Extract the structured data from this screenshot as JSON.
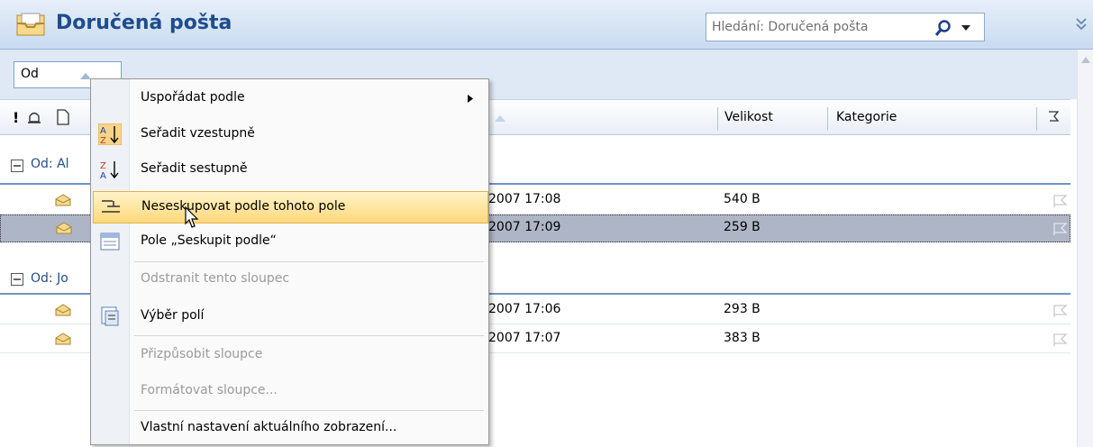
{
  "header": {
    "title": "Doručená pošta",
    "search_placeholder": "Hledání: Doručená pošta"
  },
  "groupbar": {
    "chip_label": "Od"
  },
  "columns": {
    "velikost": "Velikost",
    "kategorie": "Kategorie"
  },
  "groups": [
    {
      "label": "Od: Al",
      "rows": [
        {
          "date": "2007 17:08",
          "size": "540 B"
        },
        {
          "date": "2007 17:09",
          "size": "259 B",
          "selected": true
        }
      ]
    },
    {
      "label": "Od: Jo",
      "rows": [
        {
          "date": "2007 17:06",
          "size": "293 B"
        },
        {
          "date": "2007 17:07",
          "size": "383 B"
        }
      ]
    }
  ],
  "menu": {
    "arrange_by": "Uspořádat podle",
    "sort_asc": "Seřadit vzestupně",
    "sort_desc": "Seřadit sestupně",
    "ungroup": "Neseskupovat podle tohoto pole",
    "group_by_box": "Pole „Seskupit podle“",
    "remove_column": "Odstranit tento sloupec",
    "field_chooser": "Výběr polí",
    "best_fit": "Přizpůsobit sloupce",
    "format_columns": "Formátovat sloupce...",
    "customize_view": "Vlastní nastavení aktuálního zobrazení..."
  }
}
